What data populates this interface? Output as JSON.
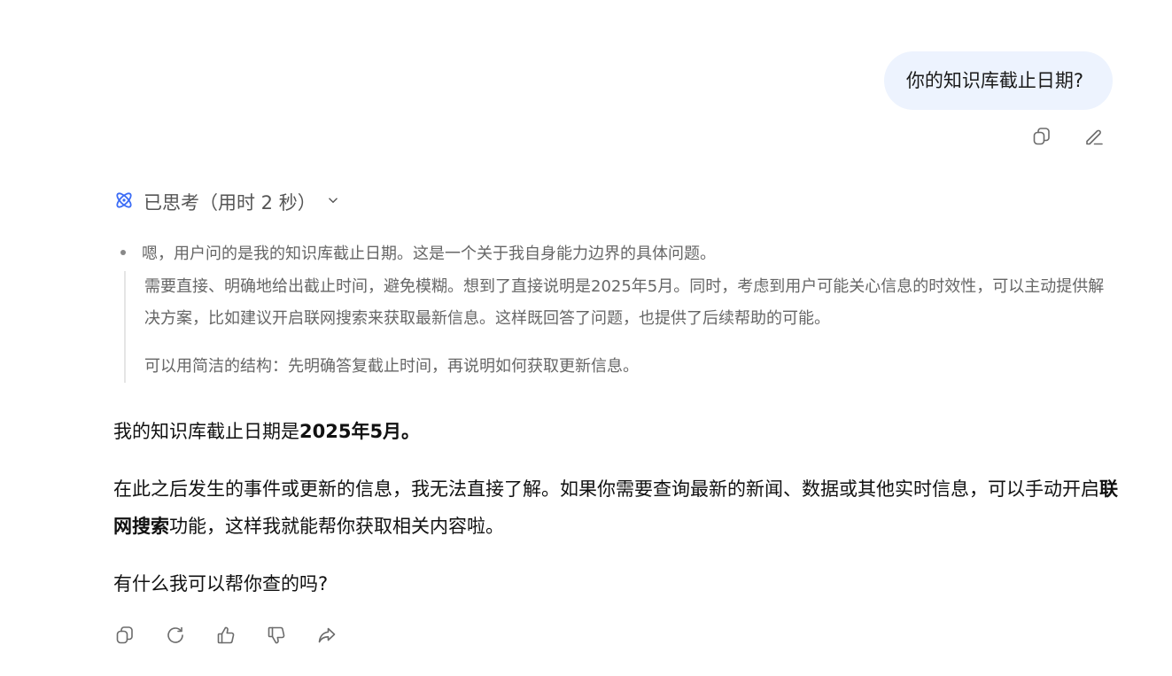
{
  "user_message": {
    "text": "你的知识库截止日期?"
  },
  "thinking": {
    "header": "已思考（用时 2 秒）",
    "bullet": "嗯，用户问的是我的知识库截止日期。这是一个关于我自身能力边界的具体问题。",
    "paragraphs": [
      "需要直接、明确地给出截止时间，避免模糊。想到了直接说明是2025年5月。同时，考虑到用户可能关心信息的时效性，可以主动提供解决方案，比如建议开启联网搜索来获取最新信息。这样既回答了问题，也提供了后续帮助的可能。",
      "可以用简洁的结构：先明确答复截止时间，再说明如何获取更新信息。"
    ]
  },
  "answer": {
    "p1_prefix": "我的知识库截止日期是",
    "p1_bold": "2025年5月。",
    "p2_prefix": "在此之后发生的事件或更新的信息，我无法直接了解。如果你需要查询最新的新闻、数据或其他实时信息，可以手动开启",
    "p2_bold": "联网搜索",
    "p2_suffix": "功能，这样我就能帮你获取相关内容啦。",
    "p3": "有什么我可以帮你查的吗?"
  },
  "icons": {
    "user_actions": [
      "copy-icon",
      "edit-icon"
    ],
    "answer_actions": [
      "copy-icon",
      "regenerate-icon",
      "thumbs-up-icon",
      "thumbs-down-icon",
      "share-icon"
    ],
    "thinking": "atom-icon"
  },
  "colors": {
    "bubble_bg": "#edf3fe",
    "accent": "#3b6cf6",
    "icon": "#6b6b6b",
    "thinking_text": "#666666"
  }
}
